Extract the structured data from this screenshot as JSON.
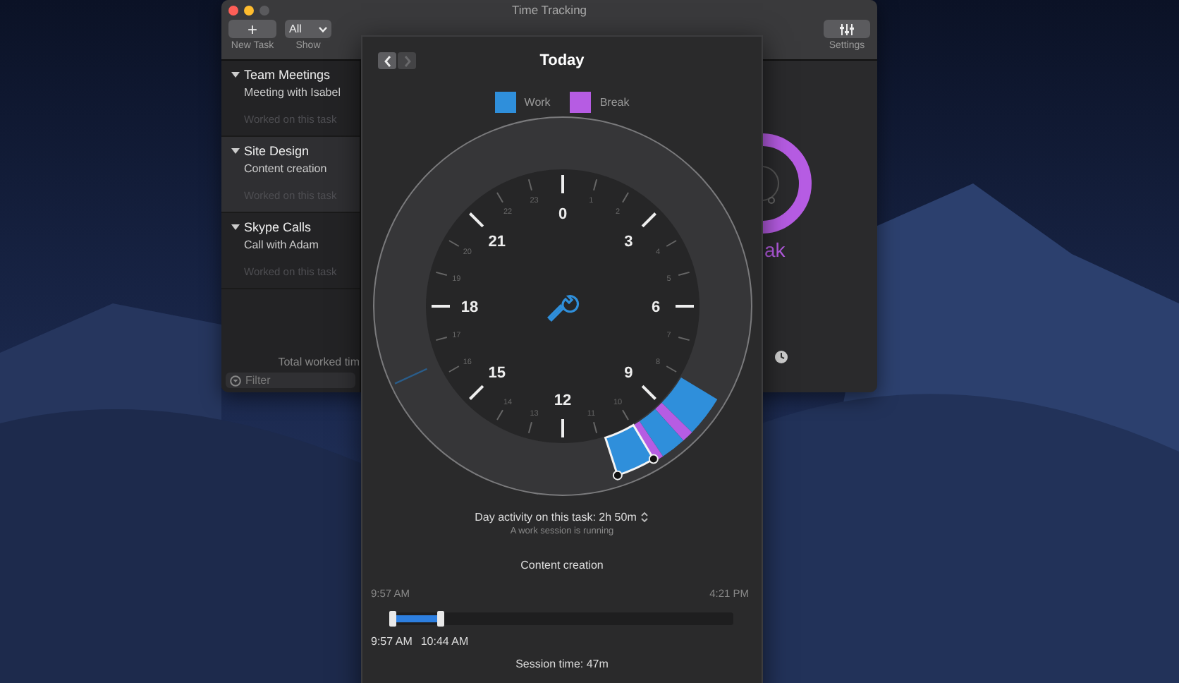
{
  "main_window": {
    "title": "Time Tracking",
    "toolbar": {
      "new_task": {
        "icon": "+",
        "label": "New Task"
      },
      "show": {
        "value": "All",
        "label": "Show"
      },
      "settings": {
        "label": "Settings"
      }
    },
    "sidebar": {
      "groups": [
        {
          "name": "Team Meetings",
          "expanded": true,
          "selected": false,
          "tasks": [
            {
              "name": "Meeting with Isabel",
              "note": "Worked on this task"
            }
          ]
        },
        {
          "name": "Site Design",
          "expanded": true,
          "selected": true,
          "tasks": [
            {
              "name": "Content creation",
              "note": "Worked on this task"
            }
          ]
        },
        {
          "name": "Skype Calls",
          "expanded": true,
          "selected": false,
          "tasks": [
            {
              "name": "Call with Adam",
              "note": "Worked on this task"
            }
          ]
        }
      ],
      "footer": "Total worked tim",
      "filter": {
        "placeholder": "Filter"
      }
    },
    "detail": {
      "label": "ak"
    }
  },
  "popover": {
    "title": "Today",
    "nav": [
      {
        "kind": "prev",
        "disabled": false
      },
      {
        "kind": "next",
        "disabled": true
      }
    ],
    "legend": [
      {
        "kind": "work",
        "label": "Work",
        "color": "#2f8fdb"
      },
      {
        "kind": "break",
        "label": "Break",
        "color": "#b65ce3"
      }
    ],
    "dial": {
      "hours": [
        "0",
        "1",
        "2",
        "3",
        "4",
        "5",
        "6",
        "7",
        "8",
        "9",
        "10",
        "11",
        "12",
        "13",
        "14",
        "15",
        "16",
        "17",
        "18",
        "19",
        "20",
        "21",
        "22",
        "23"
      ]
    },
    "activity": "Day activity on this task: 2h 50m",
    "status": "A work session is running",
    "task": "Content creation",
    "range": {
      "start": "9:57 AM",
      "end": "4:21 PM"
    },
    "session_slider": {
      "level": 0.14
    },
    "session": {
      "start": "9:57 AM",
      "end": "10:44 AM"
    },
    "session_time": "Session time: 47m"
  }
}
